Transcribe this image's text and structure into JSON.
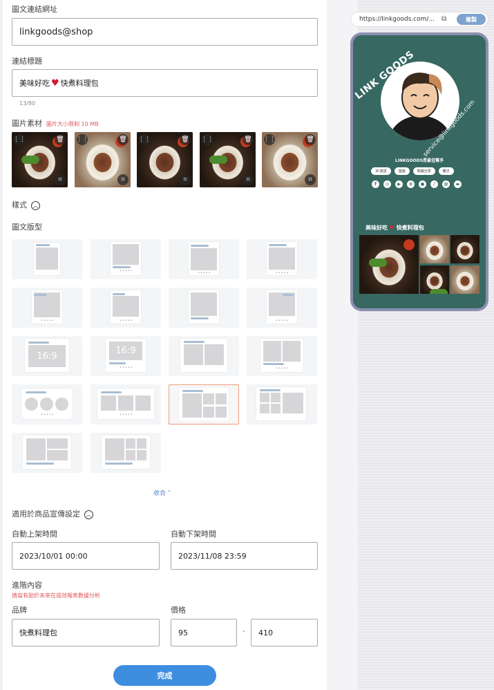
{
  "form": {
    "url_label": "圖文連結網址",
    "url_value": "linkgoods@shop",
    "title_label": "連結標題",
    "title_before": "美味好吃",
    "title_after": "快煮料理包",
    "title_count": "13/80",
    "images_label": "圖片素材",
    "images_hint": "圖片大小限制 10 MB",
    "style_label": "樣式",
    "layout_label": "圖文版型",
    "collapse_label": "收合",
    "ratio_text": "16:9",
    "promo_label": "適用於商品宣傳設定",
    "auto_on_label": "自動上架時間",
    "auto_on_value": "2023/10/01 00:00",
    "auto_off_label": "自動下架時間",
    "auto_off_value": "2023/11/08 23:59",
    "advanced_label": "進階內容",
    "advanced_hint": "填寫有助於未來在成效報表數據分析",
    "brand_label": "品牌",
    "brand_value": "快煮料理包",
    "price_label": "價格",
    "price_min": "95",
    "price_sep": "-",
    "price_max": "410",
    "done_label": "完成"
  },
  "preview": {
    "url": "https://linkgoods.com/...",
    "copy_label": "複製",
    "brand_name": "LINK GOODS",
    "email": "service@linkgoods.com",
    "tagline": "LINKGOODS是最佳幫手",
    "chips": [
      "3C資訊",
      "遊遊",
      "知識分享",
      "親子"
    ],
    "post_before": "美味好吃",
    "post_after": "快煮料理包"
  },
  "colors": {
    "accent": "#3e8ee0",
    "phone_bg": "#376862",
    "selected_border": "#f09a7a"
  }
}
